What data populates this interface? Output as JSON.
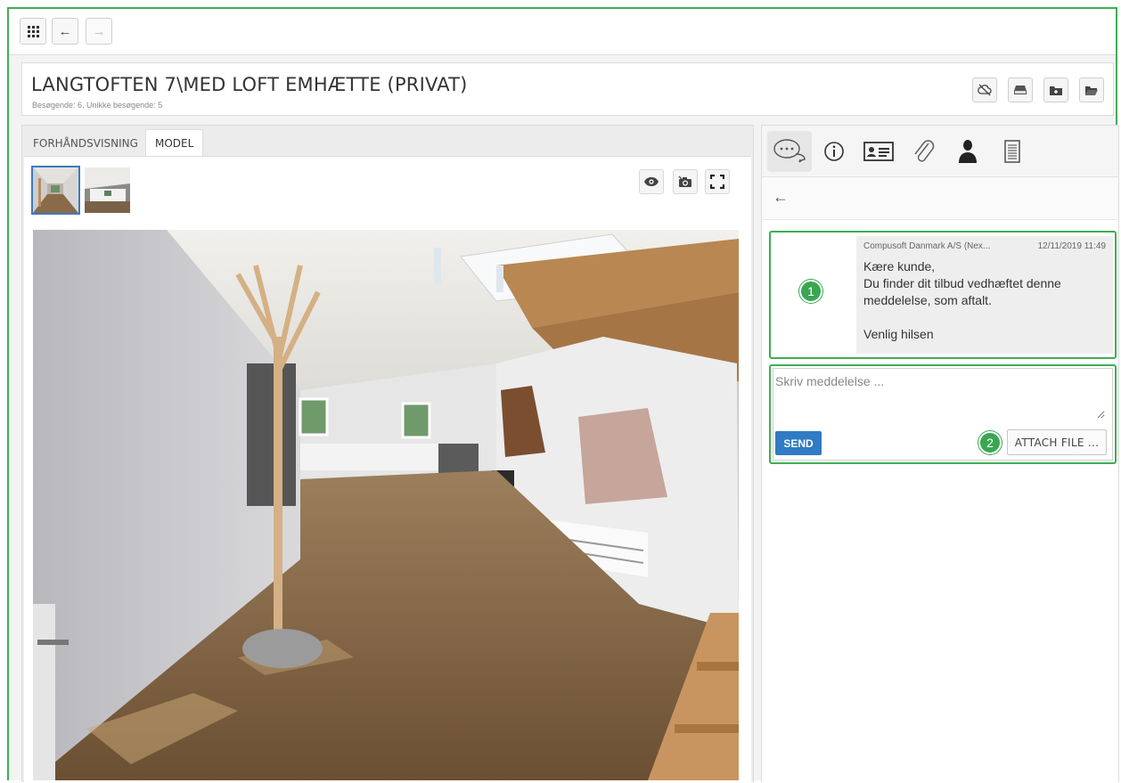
{
  "toolbar": {
    "apps_icon": "grid-icon",
    "back_icon": "←",
    "forward_icon": "→"
  },
  "header": {
    "title": "LANGTOFTEN 7\\MED LOFT EMHÆTTE (PRIVAT)",
    "subtitle": "Besøgende: 6, Unikke besøgende: 5",
    "actions": [
      "cloud-off-icon",
      "drive-icon",
      "folder-add-icon",
      "folder-open-icon"
    ]
  },
  "left": {
    "tabs": [
      {
        "label": "FORHÅNDSVISNING",
        "active": false
      },
      {
        "label": "MODEL",
        "active": true
      }
    ],
    "viewer_actions": [
      "eye-icon",
      "camera-icon",
      "fullscreen-icon"
    ]
  },
  "right": {
    "tabs": [
      "chat-icon",
      "info-icon",
      "contact-card-icon",
      "paperclip-icon",
      "person-icon",
      "notes-icon"
    ],
    "back_icon": "←",
    "message": {
      "sender": "Compusoft Danmark A/S (Nex...",
      "timestamp": "12/11/2019 11:49",
      "body": "Kære kunde,\nDu finder dit tilbud vedhæftet denne meddelelse, som aftalt.\n\nVenlig hilsen"
    },
    "compose": {
      "placeholder": "Skriv meddelelse ...",
      "send_label": "SEND",
      "attach_label": "ATTACH FILE ..."
    },
    "badges": [
      "1",
      "2"
    ]
  },
  "colors": {
    "accent_green": "#3fae55",
    "primary_blue": "#2f7bc4"
  }
}
